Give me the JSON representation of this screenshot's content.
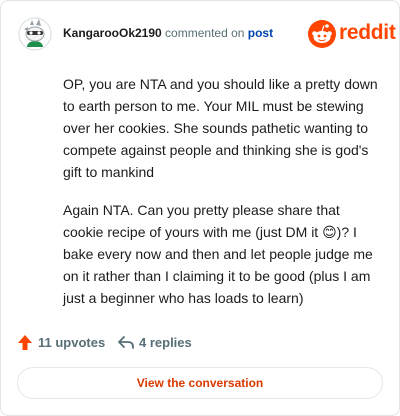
{
  "header": {
    "username": "KangarooOk2190",
    "action_text": " commented on ",
    "post_link": "post",
    "brand_name": "reddit"
  },
  "comment": {
    "paragraphs": [
      "OP, you are NTA and you should like a pretty down to earth person to me. Your MIL must be stewing over her cookies. She sounds pathetic wanting to compete against people and thinking she is god's gift to mankind",
      "Again NTA. Can you pretty please share that cookie recipe of yours with me (just DM it 😊)? I bake every now and then and let people judge me on it rather than I claiming it to be good (plus I am just a beginner who has loads to learn)"
    ]
  },
  "footer": {
    "upvotes_label": "11 upvotes",
    "replies_label": "4 replies"
  },
  "actions": {
    "view_conversation_label": "View the conversation"
  },
  "colors": {
    "brand_orange": "#ff4500",
    "link_blue": "#0045ac",
    "upvote_red": "#ff4500",
    "button_text": "#d93900",
    "muted_text": "#576f76"
  },
  "icons": {
    "avatar": "snoo-avatar",
    "logo": "reddit-snoo-logo",
    "upvote": "upvote-arrow-icon",
    "reply": "reply-arrow-icon"
  }
}
